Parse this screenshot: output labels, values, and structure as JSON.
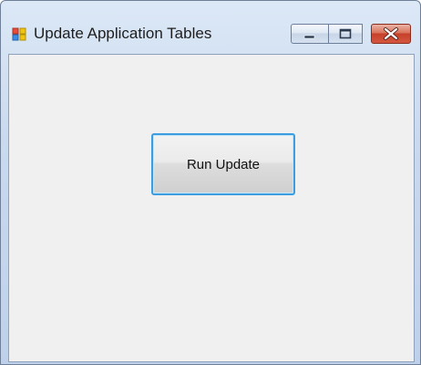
{
  "window": {
    "title": "Update Application Tables",
    "app_icon": "windows-form-icon",
    "caption_buttons": {
      "minimize_icon": "minimize-icon",
      "maximize_icon": "maximize-icon",
      "close_icon": "close-icon"
    }
  },
  "main": {
    "run_button_label": "Run Update"
  },
  "colors": {
    "titlebar": "#c9d9ee",
    "client_background": "#f0f0f0",
    "close_button": "#c7402a",
    "button_focus_border": "#3c9ee0"
  }
}
